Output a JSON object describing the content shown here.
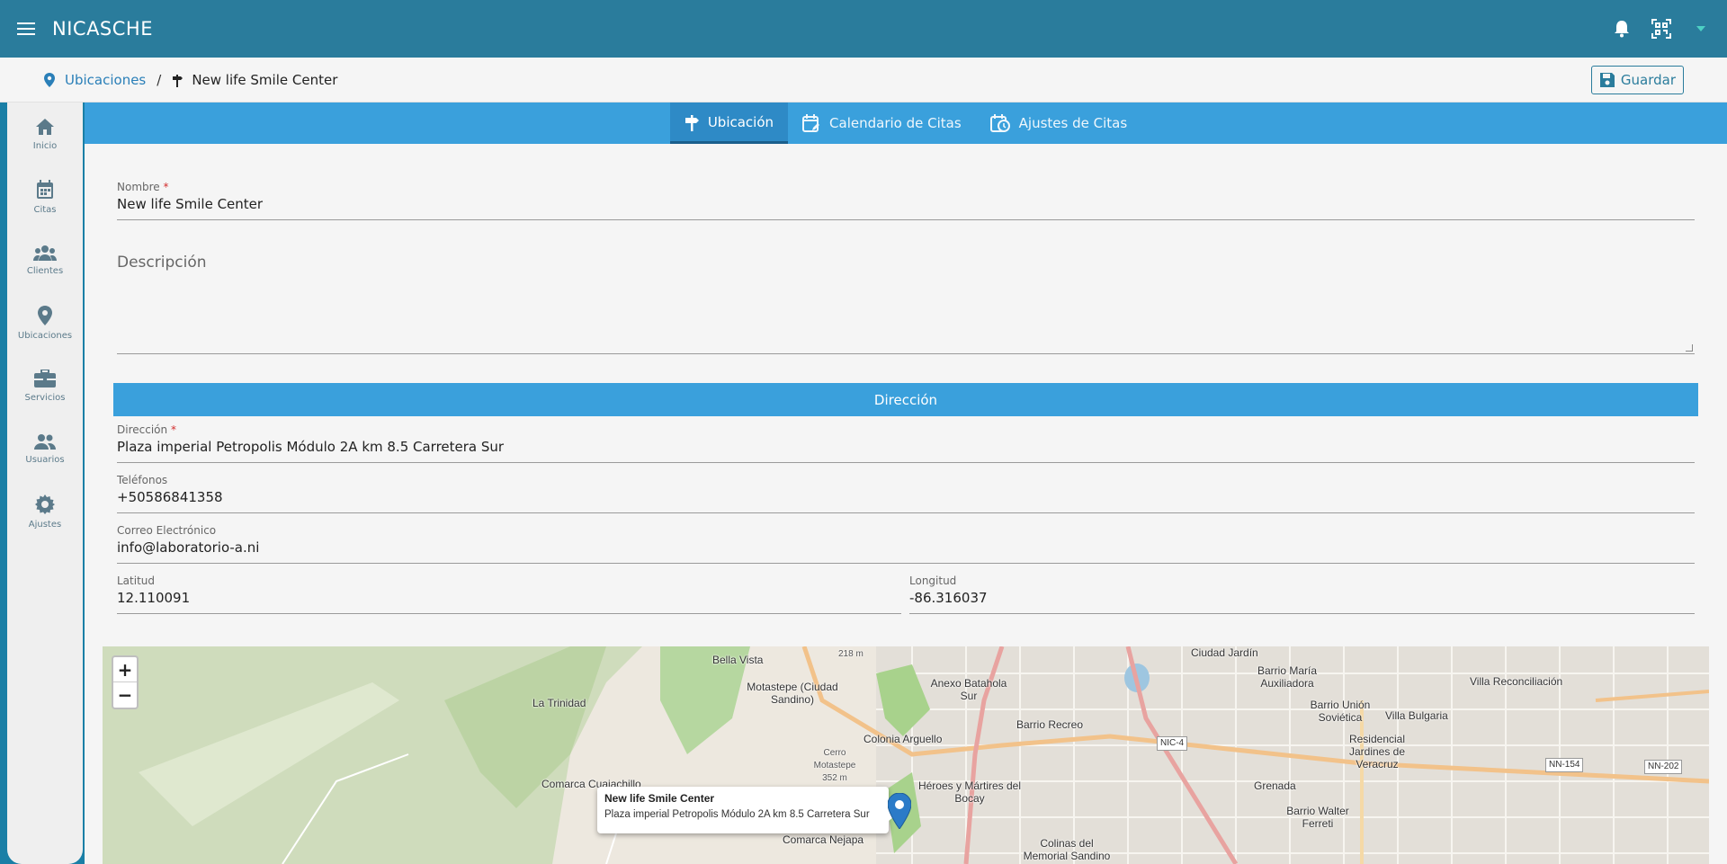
{
  "header": {
    "title": "NICASCHE"
  },
  "breadcrumb": {
    "parent": "Ubicaciones",
    "separator": "/",
    "current": "New life Smile Center",
    "save_label": "Guardar"
  },
  "sidebar": {
    "items": [
      {
        "label": "Inicio",
        "icon": "home-icon"
      },
      {
        "label": "Citas",
        "icon": "calendar-icon"
      },
      {
        "label": "Clientes",
        "icon": "group-icon"
      },
      {
        "label": "Ubicaciones",
        "icon": "location-pin-icon"
      },
      {
        "label": "Servicios",
        "icon": "briefcase-icon"
      },
      {
        "label": "Usuarios",
        "icon": "users-icon"
      },
      {
        "label": "Ajustes",
        "icon": "gear-icon"
      }
    ]
  },
  "tabs": [
    {
      "label": "Ubicación",
      "icon": "signpost-icon",
      "active": true
    },
    {
      "label": "Calendario de Citas",
      "icon": "calendar-edit-icon",
      "active": false
    },
    {
      "label": "Ajustes de Citas",
      "icon": "calendar-clock-icon",
      "active": false
    }
  ],
  "form": {
    "name_label": "Nombre",
    "name_value": "New life Smile Center",
    "required_mark": "*",
    "description_placeholder": "Descripción",
    "address_section": "Dirección",
    "address_label": "Dirección",
    "address_value": "Plaza imperial Petropolis Módulo 2A km 8.5 Carretera Sur",
    "phones_label": "Teléfonos",
    "phones_value": "+50586841358",
    "email_label": "Correo Electrónico",
    "email_value": "info@laboratorio-a.ni",
    "lat_label": "Latitud",
    "lat_value": "12.110091",
    "lng_label": "Longitud",
    "lng_value": "-86.316037"
  },
  "map": {
    "zoom_in": "+",
    "zoom_out": "−",
    "popup_title": "New life Smile Center",
    "popup_address": "Plaza imperial Petropolis Módulo 2A km 8.5 Carretera Sur",
    "places": [
      "Bella Vista",
      "La Trinidad",
      "Motastepe (Ciudad Sandino)",
      "Colonia Arguello",
      "Anexo Batahola Sur",
      "Barrio Recreo",
      "Ciudad Jardín",
      "Barrio María Auxiliadora",
      "Barrio Unión Soviética",
      "Villa Reconciliación",
      "Villa Bulgaria",
      "Residencial Jardines de Veracruz",
      "Grenada",
      "Barrio Walter Ferreti",
      "Héroes y Mártires del Bocay",
      "Comarca Cuajachillo",
      "Comarca Nejapa",
      "Colinas del Memorial Sandino",
      "NIC-4",
      "NN-154",
      "NN-202",
      "Cerro Motastepe 352 m",
      "218 m"
    ]
  }
}
